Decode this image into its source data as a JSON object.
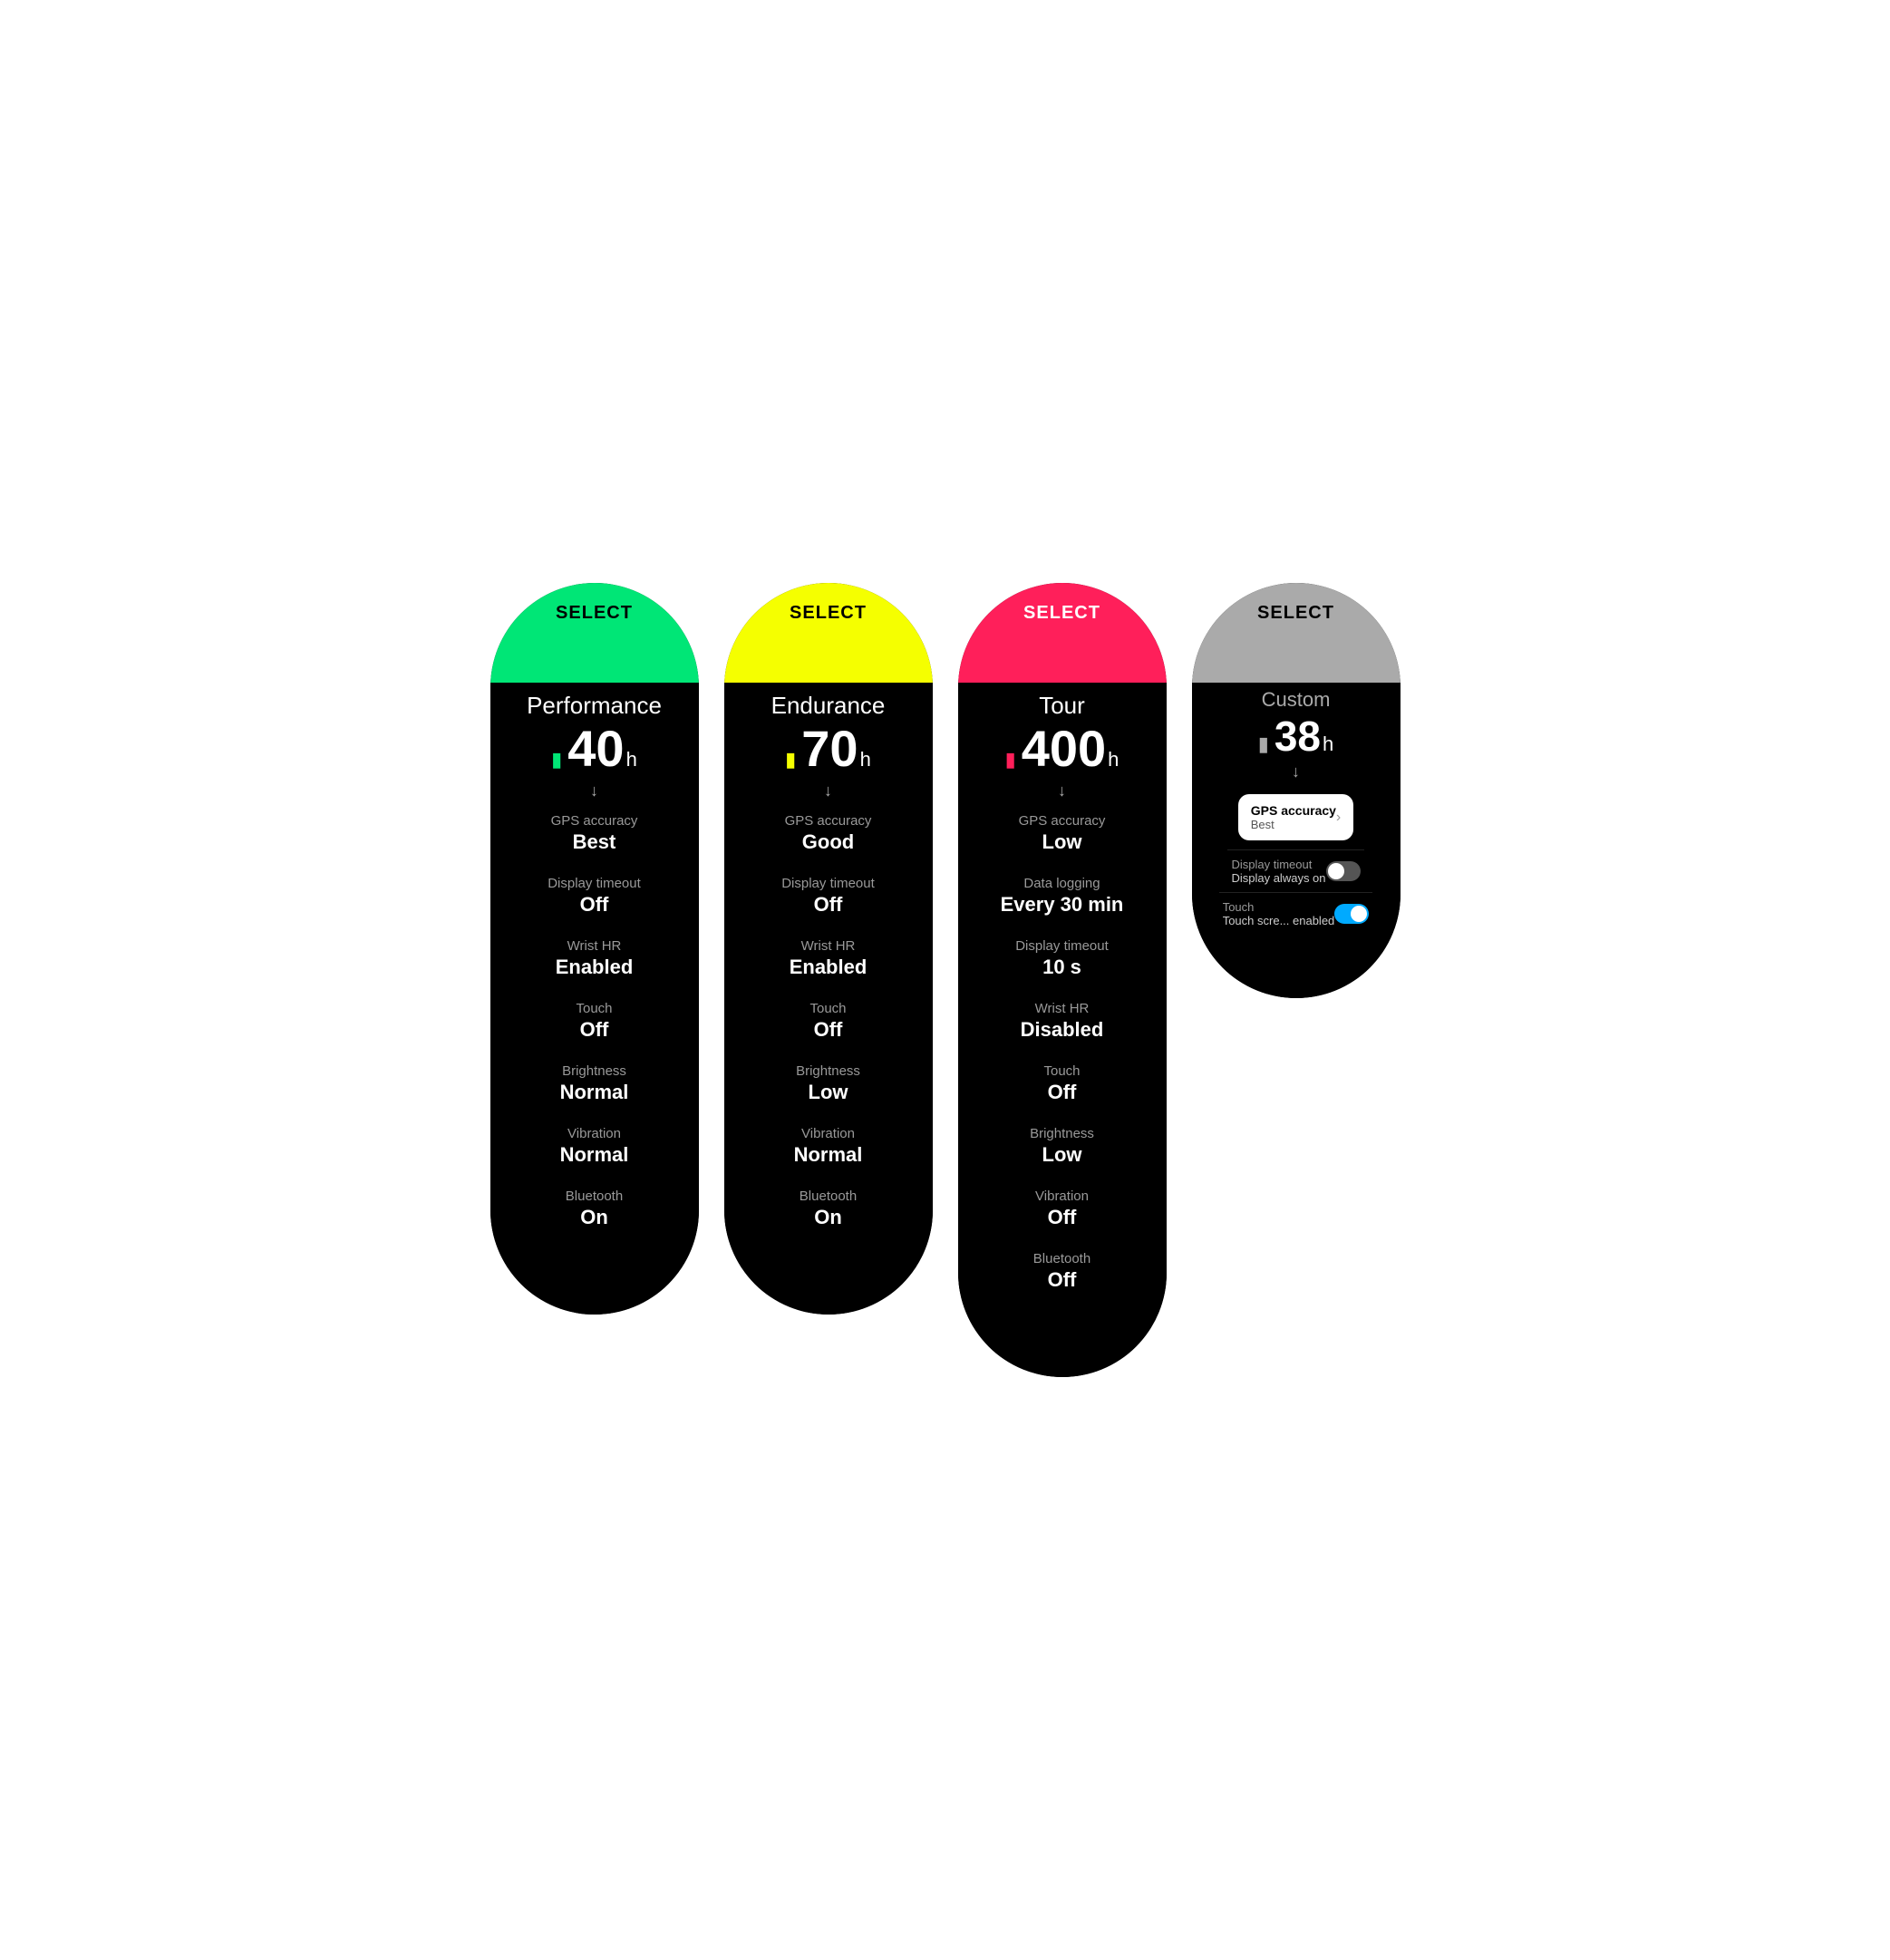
{
  "panels": [
    {
      "id": "performance",
      "top_color": "#00e676",
      "select_label": "SELECT",
      "select_label_color": "#000",
      "mode_name": "Performance",
      "battery_hours": "40",
      "battery_color": "#00e676",
      "settings": [
        {
          "label": "GPS accuracy",
          "value": "Best"
        },
        {
          "label": "Display timeout",
          "value": "Off"
        },
        {
          "label": "Wrist HR",
          "value": "Enabled"
        },
        {
          "label": "Touch",
          "value": "Off"
        },
        {
          "label": "Brightness",
          "value": "Normal"
        },
        {
          "label": "Vibration",
          "value": "Normal"
        },
        {
          "label": "Bluetooth",
          "value": "On"
        }
      ]
    },
    {
      "id": "endurance",
      "top_color": "#f5ff00",
      "select_label": "SELECT",
      "select_label_color": "#000",
      "mode_name": "Endurance",
      "battery_hours": "70",
      "battery_color": "#f5ff00",
      "settings": [
        {
          "label": "GPS accuracy",
          "value": "Good"
        },
        {
          "label": "Display timeout",
          "value": "Off"
        },
        {
          "label": "Wrist HR",
          "value": "Enabled"
        },
        {
          "label": "Touch",
          "value": "Off"
        },
        {
          "label": "Brightness",
          "value": "Low"
        },
        {
          "label": "Vibration",
          "value": "Normal"
        },
        {
          "label": "Bluetooth",
          "value": "On"
        }
      ]
    },
    {
      "id": "tour",
      "top_color": "#ff1f5a",
      "select_label": "SELECT",
      "select_label_color": "#fff",
      "mode_name": "Tour",
      "battery_hours": "400",
      "battery_color": "#ff1f5a",
      "settings": [
        {
          "label": "GPS accuracy",
          "value": "Low"
        },
        {
          "label": "Data logging",
          "value": "Every 30 min"
        },
        {
          "label": "Display timeout",
          "value": "10 s"
        },
        {
          "label": "Wrist HR",
          "value": "Disabled"
        },
        {
          "label": "Touch",
          "value": "Off"
        },
        {
          "label": "Brightness",
          "value": "Low"
        },
        {
          "label": "Vibration",
          "value": "Off"
        },
        {
          "label": "Bluetooth",
          "value": "Off"
        }
      ]
    }
  ],
  "custom_panel": {
    "top_color": "#aaaaaa",
    "select_label": "SELECT",
    "select_label_color": "#000",
    "mode_name": "Custom",
    "battery_hours": "38",
    "battery_color": "#aaaaaa",
    "gps_accuracy": {
      "label": "GPS accuracy",
      "value": "Best"
    },
    "display_timeout": {
      "label": "Display timeout",
      "value": "Display always on",
      "toggle": "off"
    },
    "touch": {
      "label": "Touch",
      "value": "Touch scre... enabled",
      "toggle": "on"
    }
  },
  "icons": {
    "battery": "🔋",
    "down_arrow": "↓",
    "chevron_right": "›"
  }
}
